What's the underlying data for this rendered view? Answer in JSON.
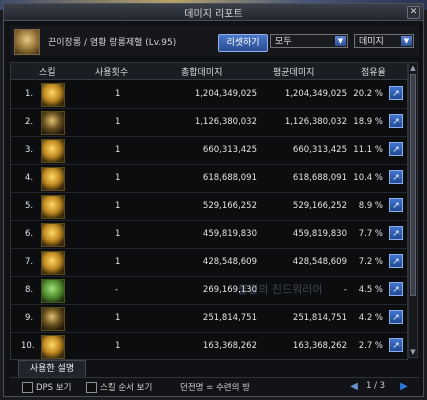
{
  "window": {
    "title": "데미지 리포트"
  },
  "character": {
    "name": "끈이장롱 / 염황 랑롱제혈 (Lv.95)"
  },
  "controls": {
    "reset_label": "리셋하기",
    "filter_select": "모두",
    "sort_select": "데미지"
  },
  "table": {
    "headers": {
      "skill": "스킬",
      "uses": "사용횟수",
      "total": "총합데미지",
      "avg": "평균데미지",
      "share": "점유율"
    },
    "rows": [
      {
        "index": "1.",
        "icon": "flame-dragon-skill-icon",
        "uses": "1",
        "total": "1,204,349,025",
        "avg": "1,204,349,025",
        "share": "20.2 %"
      },
      {
        "index": "2.",
        "icon": "phoenix-wing-skill-icon",
        "uses": "1",
        "total": "1,126,380,032",
        "avg": "1,126,380,032",
        "share": "18.9 %"
      },
      {
        "index": "3.",
        "icon": "dragon-head-skill-icon",
        "uses": "1",
        "total": "660,313,425",
        "avg": "660,313,425",
        "share": "11.1 %"
      },
      {
        "index": "4.",
        "icon": "dash-strike-skill-icon",
        "uses": "1",
        "total": "618,688,091",
        "avg": "618,688,091",
        "share": "10.4 %"
      },
      {
        "index": "5.",
        "icon": "golden-orb-skill-icon",
        "uses": "1",
        "total": "529,166,252",
        "avg": "529,166,252",
        "share": "8.9 %"
      },
      {
        "index": "6.",
        "icon": "spin-burst-skill-icon",
        "uses": "1",
        "total": "459,819,830",
        "avg": "459,819,830",
        "share": "7.7 %"
      },
      {
        "index": "7.",
        "icon": "fire-kick-skill-icon",
        "uses": "1",
        "total": "428,548,609",
        "avg": "428,548,609",
        "share": "7.2 %"
      },
      {
        "index": "8.",
        "icon": "pagoda-skill-icon",
        "uses": "-",
        "total": "269,169,130",
        "avg": "-",
        "share": "4.5 %"
      },
      {
        "index": "9.",
        "icon": "sun-ring-skill-icon",
        "uses": "1",
        "total": "251,814,751",
        "avg": "251,814,751",
        "share": "4.2 %"
      },
      {
        "index": "10.",
        "icon": "ignite-aura-skill-icon",
        "uses": "1",
        "total": "163,368,262",
        "avg": "163,368,262",
        "share": "2.7 %"
      }
    ]
  },
  "watermark": {
    "text": "불멸의 진드워러어"
  },
  "tabs": {
    "description_label": "사용한 설명"
  },
  "footer": {
    "dps_label": "DPS 보기",
    "order_label": "스킬 순서 보기",
    "dungeon_label": "던전명 = 수련의 방",
    "page_label": "1 / 3"
  }
}
